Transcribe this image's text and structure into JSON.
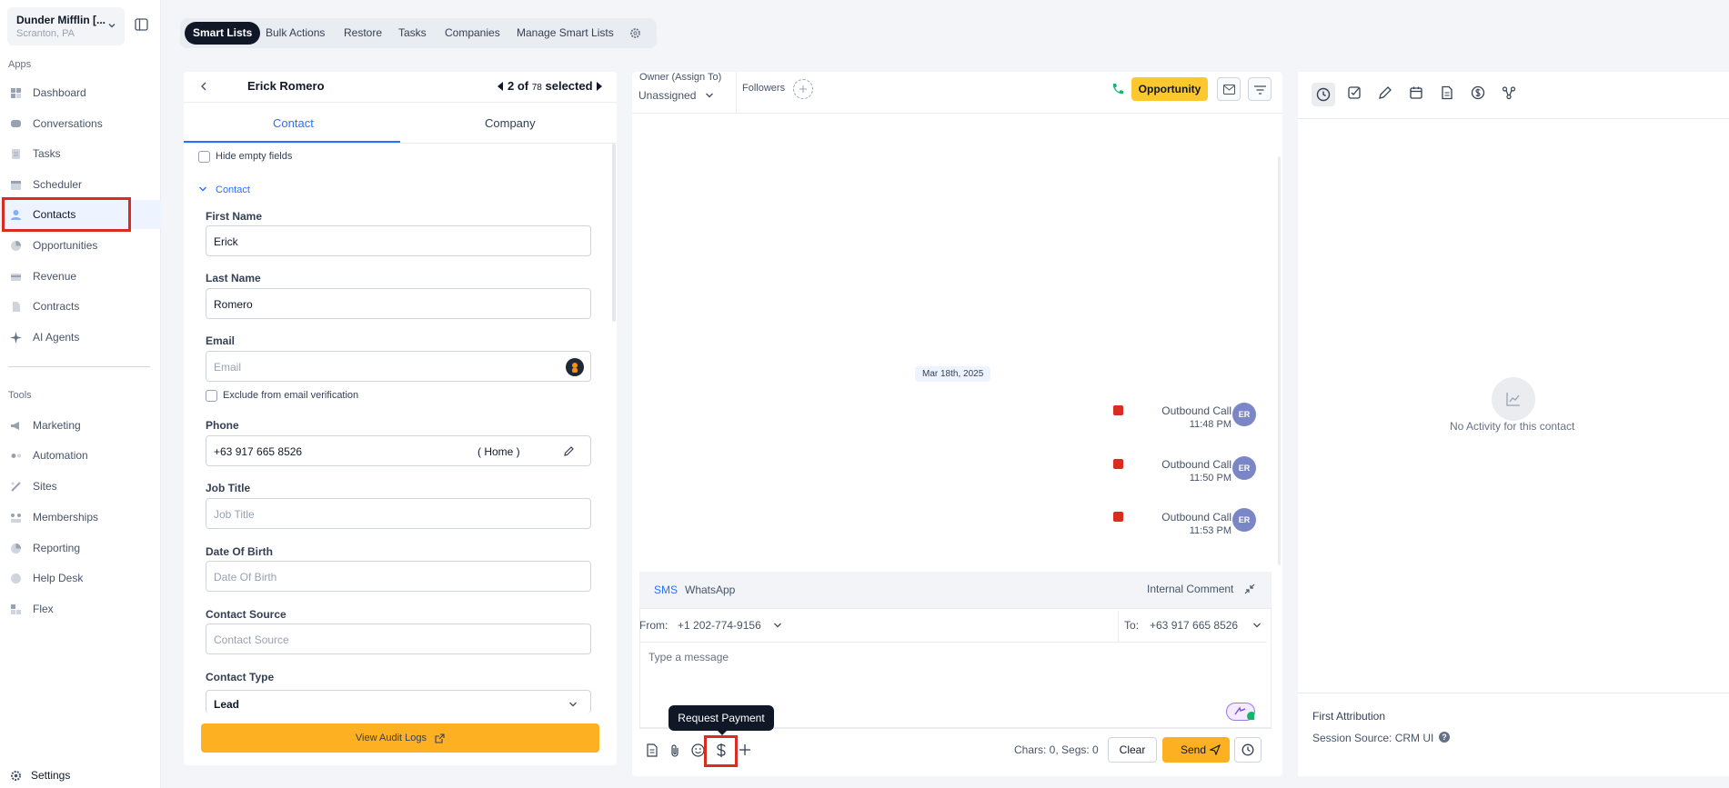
{
  "sidebar": {
    "location_name": "Dunder Mifflin [...",
    "location_sub": "Scranton, PA",
    "apps_label": "Apps",
    "tools_label": "Tools",
    "apps": [
      {
        "label": "Dashboard",
        "icon": "dashboard-icon"
      },
      {
        "label": "Conversations",
        "icon": "chat-icon"
      },
      {
        "label": "Tasks",
        "icon": "task-icon"
      },
      {
        "label": "Scheduler",
        "icon": "calendar-icon"
      },
      {
        "label": "Contacts",
        "icon": "person-icon"
      },
      {
        "label": "Opportunities",
        "icon": "opportunity-icon"
      },
      {
        "label": "Revenue",
        "icon": "card-icon"
      },
      {
        "label": "Contracts",
        "icon": "document-icon"
      },
      {
        "label": "AI Agents",
        "icon": "sparkle-icon"
      }
    ],
    "tools": [
      {
        "label": "Marketing",
        "icon": "megaphone-icon"
      },
      {
        "label": "Automation",
        "icon": "automation-icon"
      },
      {
        "label": "Sites",
        "icon": "sites-icon"
      },
      {
        "label": "Memberships",
        "icon": "members-icon"
      },
      {
        "label": "Reporting",
        "icon": "pie-icon"
      },
      {
        "label": "Help Desk",
        "icon": "help-icon"
      },
      {
        "label": "Flex",
        "icon": "flex-icon"
      }
    ],
    "settings_label": "Settings"
  },
  "topbar": {
    "active": "Smart Lists",
    "items": [
      "Bulk Actions",
      "Restore",
      "Tasks",
      "Companies",
      "Manage Smart Lists"
    ]
  },
  "contact": {
    "name": "Erick Romero",
    "pager_current": "2 of",
    "pager_total": "78",
    "pager_suffix": "selected",
    "tabs": [
      "Contact",
      "Company"
    ],
    "hide_empty": "Hide empty fields",
    "section": "Contact",
    "first_name_label": "First Name",
    "first_name": "Erick",
    "last_name_label": "Last Name",
    "last_name": "Romero",
    "email_label": "Email",
    "email_placeholder": "Email",
    "exclude_label": "Exclude from email verification",
    "phone_label": "Phone",
    "phone": "+63 917 665 8526",
    "phone_type": "( Home )",
    "job_title_label": "Job Title",
    "job_title_placeholder": "Job Title",
    "dob_label": "Date Of Birth",
    "dob_placeholder": "Date Of Birth",
    "source_label": "Contact Source",
    "source_placeholder": "Contact Source",
    "type_label": "Contact Type",
    "type_value": "Lead",
    "audit_button": "View Audit Logs"
  },
  "conversation": {
    "owner_label": "Owner (Assign To)",
    "owner_value": "Unassigned",
    "followers_label": "Followers",
    "opportunity_button": "Opportunity",
    "date_chip": "Mar 18th, 2025",
    "messages": [
      {
        "title": "Outbound Call",
        "time": "11:48 PM",
        "avatar": "ER"
      },
      {
        "title": "Outbound Call",
        "time": "11:50 PM",
        "avatar": "ER"
      },
      {
        "title": "Outbound Call",
        "time": "11:53 PM",
        "avatar": "ER"
      }
    ],
    "compose_tabs": [
      "SMS",
      "WhatsApp"
    ],
    "internal_comment": "Internal Comment",
    "from_label": "From:",
    "from_number": "+1 202-774-9156",
    "to_label": "To:",
    "to_number": "+63 917 665 8526",
    "message_placeholder": "Type a message",
    "tooltip": "Request Payment",
    "chars_info": "Chars: 0, Segs: 0",
    "clear_button": "Clear",
    "send_button": "Send"
  },
  "activity": {
    "empty_text": "No Activity for this contact",
    "attribution_title": "First Attribution",
    "session_source": "Session Source: CRM UI"
  },
  "colors": {
    "accent": "#2970ff",
    "highlight": "#d92d20",
    "primary_button": "#fdb022",
    "dark": "#101828"
  }
}
